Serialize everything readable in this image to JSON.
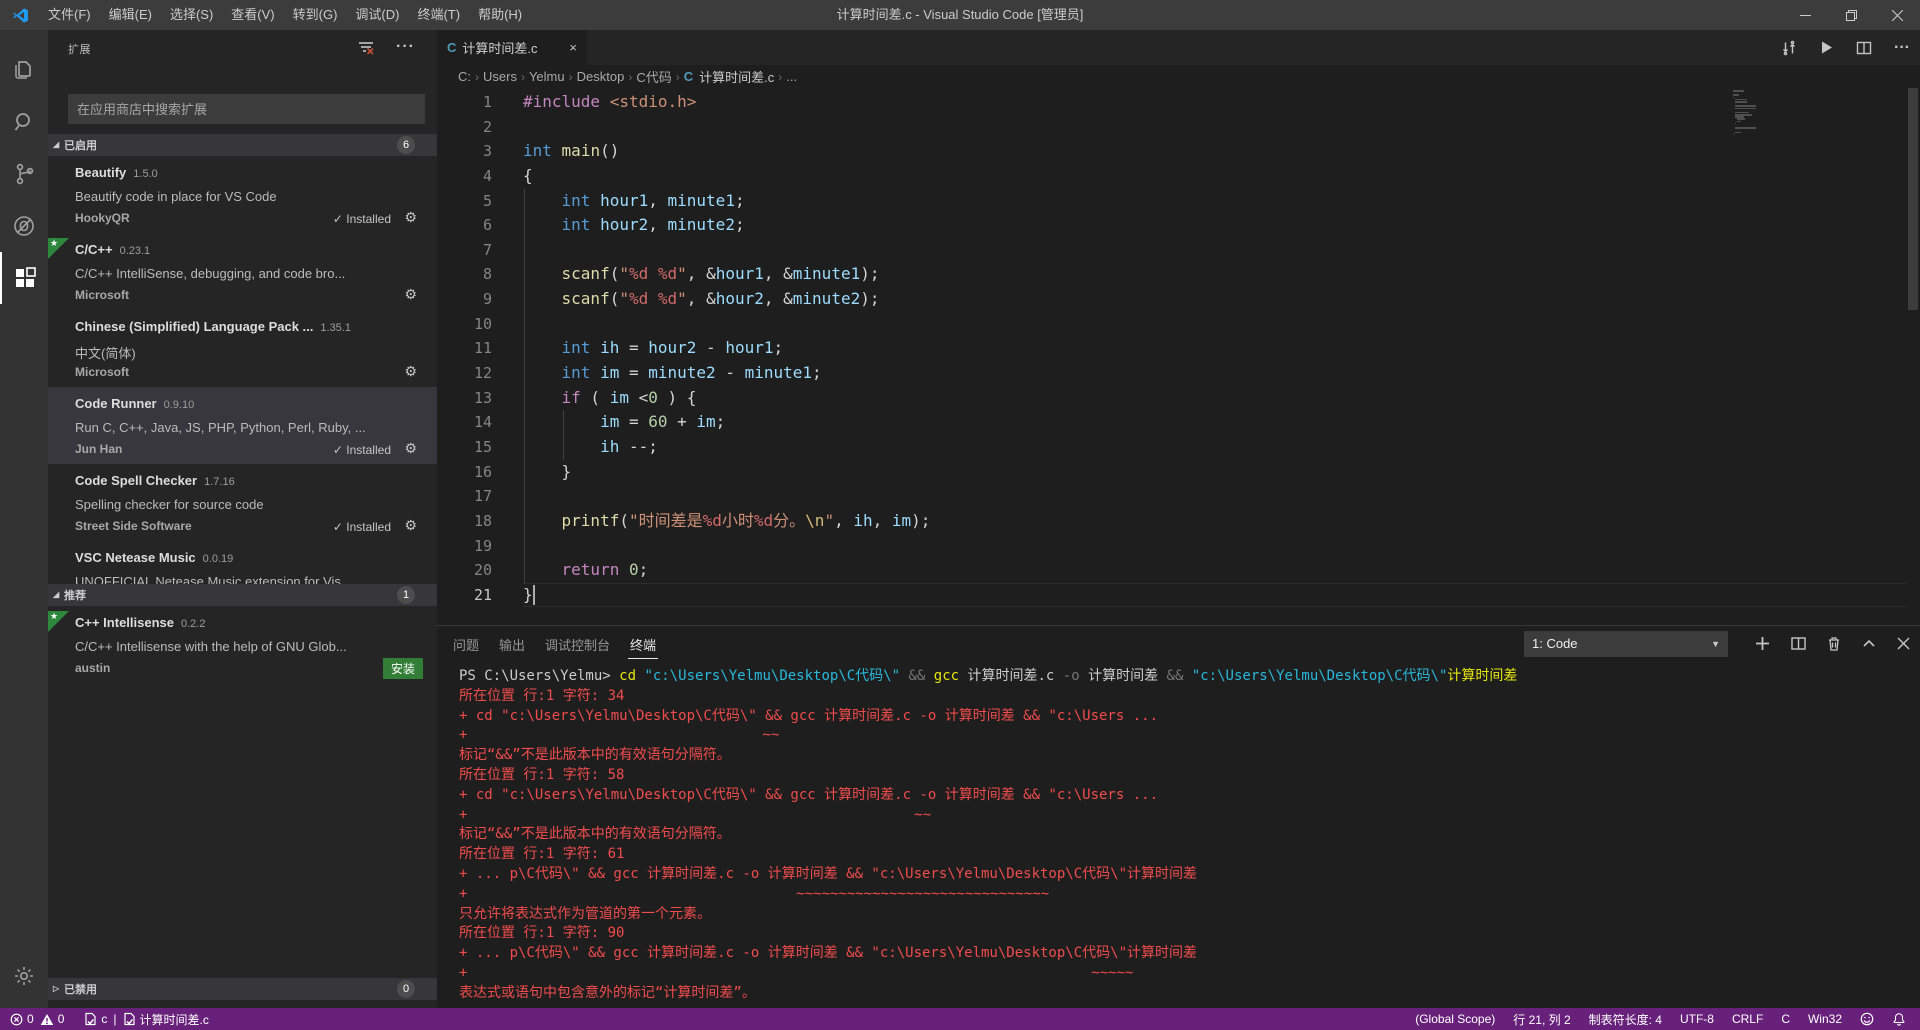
{
  "title_bar": {
    "menus": [
      "文件(F)",
      "编辑(E)",
      "选择(S)",
      "查看(V)",
      "转到(G)",
      "调试(D)",
      "终端(T)",
      "帮助(H)"
    ],
    "title": "计算时间差.c - Visual Studio Code [管理员]"
  },
  "activity_bar": {
    "icons": [
      "explorer",
      "search",
      "source-control",
      "debug",
      "extensions",
      "manage"
    ]
  },
  "sidebar": {
    "header_title": "扩展",
    "search_placeholder": "在应用商店中搜索扩展",
    "installed_label": "Installed",
    "install_button_label": "安装",
    "sections": {
      "enabled": {
        "label": "已启用",
        "badge": "6",
        "expanded": true
      },
      "recommended": {
        "label": "推荐",
        "badge": "1",
        "expanded": true
      },
      "disabled": {
        "label": "已禁用",
        "badge": "0",
        "expanded": false
      }
    },
    "enabled_items": [
      {
        "name": "Beautify",
        "version": "1.5.0",
        "desc": "Beautify code in place for VS Code",
        "author": "HookyQR",
        "installed": true,
        "gear": true,
        "star": false,
        "selected": false,
        "clipped": false
      },
      {
        "name": "C/C++",
        "version": "0.23.1",
        "desc": "C/C++ IntelliSense, debugging, and code bro...",
        "author": "Microsoft",
        "installed": false,
        "gear": true,
        "star": true,
        "selected": false,
        "clipped": false
      },
      {
        "name": "Chinese (Simplified) Language Pack ...",
        "version": "1.35.1",
        "desc": "中文(简体)",
        "author": "Microsoft",
        "installed": false,
        "gear": true,
        "star": false,
        "selected": false,
        "clipped": false
      },
      {
        "name": "Code Runner",
        "version": "0.9.10",
        "desc": "Run C, C++, Java, JS, PHP, Python, Perl, Ruby, ...",
        "author": "Jun Han",
        "installed": true,
        "gear": true,
        "star": false,
        "selected": true,
        "clipped": false
      },
      {
        "name": "Code Spell Checker",
        "version": "1.7.16",
        "desc": "Spelling checker for source code",
        "author": "Street Side Software",
        "installed": true,
        "gear": true,
        "star": false,
        "selected": false,
        "clipped": false
      },
      {
        "name": "VSC Netease Music",
        "version": "0.0.19",
        "desc": "UNOFFICIAL Netease Music extension for Vis...",
        "author": "",
        "installed": false,
        "gear": false,
        "star": false,
        "selected": false,
        "clipped": true
      }
    ],
    "recommended_items": [
      {
        "name": "C++ Intellisense",
        "version": "0.2.2",
        "desc": "C/C++ Intellisense with the help of GNU Glob...",
        "author": "austin",
        "installed": false,
        "gear": false,
        "star": true,
        "selected": false,
        "clipped": false,
        "action": "安装"
      }
    ]
  },
  "editor": {
    "tab": {
      "label": "计算时间差.c",
      "icon": "C",
      "close": "×"
    },
    "breadcrumb_folders": [
      "C:",
      "Users",
      "Yelmu",
      "Desktop",
      "C代码"
    ],
    "breadcrumb_file": "计算时间差.c",
    "breadcrumb_more": "...",
    "cursor_line": 21,
    "cursor_col": 2,
    "code_lines": [
      {
        "spans": [
          [
            "kw",
            "#include"
          ],
          [
            "pl",
            " "
          ],
          [
            "str",
            "<stdio.h>"
          ]
        ]
      },
      {
        "spans": []
      },
      {
        "spans": [
          [
            "type",
            "int"
          ],
          [
            "pl",
            " "
          ],
          [
            "fn",
            "main"
          ],
          [
            "pl",
            "()"
          ]
        ]
      },
      {
        "spans": [
          [
            "pl",
            "{"
          ]
        ]
      },
      {
        "spans": [
          [
            "pl",
            "    "
          ],
          [
            "type",
            "int"
          ],
          [
            "pl",
            " "
          ],
          [
            "var",
            "hour1"
          ],
          [
            "pl",
            ", "
          ],
          [
            "var",
            "minute1"
          ],
          [
            "pl",
            ";"
          ]
        ]
      },
      {
        "spans": [
          [
            "pl",
            "    "
          ],
          [
            "type",
            "int"
          ],
          [
            "pl",
            " "
          ],
          [
            "var",
            "hour2"
          ],
          [
            "pl",
            ", "
          ],
          [
            "var",
            "minute2"
          ],
          [
            "pl",
            ";"
          ]
        ]
      },
      {
        "spans": []
      },
      {
        "spans": [
          [
            "pl",
            "    "
          ],
          [
            "fn",
            "scanf"
          ],
          [
            "pl",
            "("
          ],
          [
            "str",
            "\""
          ],
          [
            "fmt",
            "%d"
          ],
          [
            "str",
            " "
          ],
          [
            "fmt",
            "%d"
          ],
          [
            "str",
            "\""
          ],
          [
            "pl",
            ", &"
          ],
          [
            "var",
            "hour1"
          ],
          [
            "pl",
            ", &"
          ],
          [
            "var",
            "minute1"
          ],
          [
            "pl",
            ");"
          ]
        ]
      },
      {
        "spans": [
          [
            "pl",
            "    "
          ],
          [
            "fn",
            "scanf"
          ],
          [
            "pl",
            "("
          ],
          [
            "str",
            "\""
          ],
          [
            "fmt",
            "%d"
          ],
          [
            "str",
            " "
          ],
          [
            "fmt",
            "%d"
          ],
          [
            "str",
            "\""
          ],
          [
            "pl",
            ", &"
          ],
          [
            "var",
            "hour2"
          ],
          [
            "pl",
            ", &"
          ],
          [
            "var",
            "minute2"
          ],
          [
            "pl",
            ");"
          ]
        ]
      },
      {
        "spans": []
      },
      {
        "spans": [
          [
            "pl",
            "    "
          ],
          [
            "type",
            "int"
          ],
          [
            "pl",
            " "
          ],
          [
            "var",
            "ih"
          ],
          [
            "pl",
            " = "
          ],
          [
            "var",
            "hour2"
          ],
          [
            "pl",
            " - "
          ],
          [
            "var",
            "hour1"
          ],
          [
            "pl",
            ";"
          ]
        ]
      },
      {
        "spans": [
          [
            "pl",
            "    "
          ],
          [
            "type",
            "int"
          ],
          [
            "pl",
            " "
          ],
          [
            "var",
            "im"
          ],
          [
            "pl",
            " = "
          ],
          [
            "var",
            "minute2"
          ],
          [
            "pl",
            " - "
          ],
          [
            "var",
            "minute1"
          ],
          [
            "pl",
            ";"
          ]
        ]
      },
      {
        "spans": [
          [
            "pl",
            "    "
          ],
          [
            "kw",
            "if"
          ],
          [
            "pl",
            " ( "
          ],
          [
            "var",
            "im"
          ],
          [
            "pl",
            " <"
          ],
          [
            "num",
            "0"
          ],
          [
            "pl",
            " ) {"
          ]
        ]
      },
      {
        "spans": [
          [
            "pl",
            "        "
          ],
          [
            "var",
            "im"
          ],
          [
            "pl",
            " = "
          ],
          [
            "num",
            "60"
          ],
          [
            "pl",
            " + "
          ],
          [
            "var",
            "im"
          ],
          [
            "pl",
            ";"
          ]
        ]
      },
      {
        "spans": [
          [
            "pl",
            "        "
          ],
          [
            "var",
            "ih"
          ],
          [
            "pl",
            " --;"
          ]
        ]
      },
      {
        "spans": [
          [
            "pl",
            "    }"
          ]
        ]
      },
      {
        "spans": []
      },
      {
        "spans": [
          [
            "pl",
            "    "
          ],
          [
            "fn",
            "printf"
          ],
          [
            "pl",
            "("
          ],
          [
            "str",
            "\"时间差是"
          ],
          [
            "fmt",
            "%d"
          ],
          [
            "str",
            "小时"
          ],
          [
            "fmt",
            "%d"
          ],
          [
            "str",
            "分。"
          ],
          [
            "esc",
            "\\n"
          ],
          [
            "str",
            "\""
          ],
          [
            "pl",
            ", "
          ],
          [
            "var",
            "ih"
          ],
          [
            "pl",
            ", "
          ],
          [
            "var",
            "im"
          ],
          [
            "pl",
            ");"
          ]
        ]
      },
      {
        "spans": []
      },
      {
        "spans": [
          [
            "pl",
            "    "
          ],
          [
            "kw",
            "return"
          ],
          [
            "pl",
            " "
          ],
          [
            "num",
            "0"
          ],
          [
            "pl",
            ";"
          ]
        ]
      },
      {
        "spans": [
          [
            "pl",
            "}"
          ]
        ]
      }
    ]
  },
  "panel": {
    "tabs": [
      "问题",
      "输出",
      "调试控制台",
      "终端"
    ],
    "active_tab": "终端",
    "dropdown_label": "1: Code",
    "terminal_lines": [
      [
        [
          "pr",
          "PS C:\\Users\\Yelmu> "
        ],
        [
          "cmd",
          "cd "
        ],
        [
          "str",
          "\"c:\\Users\\Yelmu\\Desktop\\C代码\\\" "
        ],
        [
          "op",
          "&& "
        ],
        [
          "cmd",
          "gcc "
        ],
        [
          "pr",
          "计算时间差.c "
        ],
        [
          "op",
          "-o "
        ],
        [
          "pr",
          "计算时间差 "
        ],
        [
          "op",
          "&& "
        ],
        [
          "str",
          "\"c:\\Users\\Yelmu\\Desktop\\C代码\\\""
        ],
        [
          "cmd",
          "计算时间差"
        ]
      ],
      [
        [
          "err",
          "所在位置 行:1 字符: 34"
        ]
      ],
      [
        [
          "err",
          "+ cd \"c:\\Users\\Yelmu\\Desktop\\C代码\\\" && gcc 计算时间差.c -o 计算时间差 && \"c:\\Users ..."
        ]
      ],
      [
        [
          "err",
          "+                                   ~~"
        ]
      ],
      [
        [
          "err",
          "标记“&&”不是此版本中的有效语句分隔符。"
        ]
      ],
      [
        [
          "err",
          "所在位置 行:1 字符: 58"
        ]
      ],
      [
        [
          "err",
          "+ cd \"c:\\Users\\Yelmu\\Desktop\\C代码\\\" && gcc 计算时间差.c -o 计算时间差 && \"c:\\Users ..."
        ]
      ],
      [
        [
          "err",
          "+                                                     ~~"
        ]
      ],
      [
        [
          "err",
          "标记“&&”不是此版本中的有效语句分隔符。"
        ]
      ],
      [
        [
          "err",
          "所在位置 行:1 字符: 61"
        ]
      ],
      [
        [
          "err",
          "+ ... p\\C代码\\\" && gcc 计算时间差.c -o 计算时间差 && \"c:\\Users\\Yelmu\\Desktop\\C代码\\\"计算时间差"
        ]
      ],
      [
        [
          "err",
          "+                                       ~~~~~~~~~~~~~~~~~~~~~~~~~~~~~~"
        ]
      ],
      [
        [
          "err",
          "只允许将表达式作为管道的第一个元素。"
        ]
      ],
      [
        [
          "err",
          "所在位置 行:1 字符: 90"
        ]
      ],
      [
        [
          "err",
          "+ ... p\\C代码\\\" && gcc 计算时间差.c -o 计算时间差 && \"c:\\Users\\Yelmu\\Desktop\\C代码\\\"计算时间差"
        ]
      ],
      [
        [
          "err",
          "+                                                                          ~~~~~"
        ]
      ],
      [
        [
          "err",
          "表达式或语句中包含意外的标记“计算时间差”。"
        ]
      ]
    ]
  },
  "status_bar": {
    "errors": "0",
    "warnings": "0",
    "spell_lang": "c",
    "divider": "|",
    "file_name": "计算时间差.c",
    "right_items": [
      "(Global Scope)",
      "行 21, 列 2",
      "制表符长度: 4",
      "UTF-8",
      "CRLF",
      "C",
      "Win32"
    ]
  },
  "colors": {
    "statusbar": "#68217A",
    "titlebar": "#3c3c3c",
    "sidebar": "#252526",
    "editor": "#1e1e1e",
    "terminal_error": "#F14C4C",
    "install_button": "#327e36",
    "c_icon": "#519aba"
  }
}
